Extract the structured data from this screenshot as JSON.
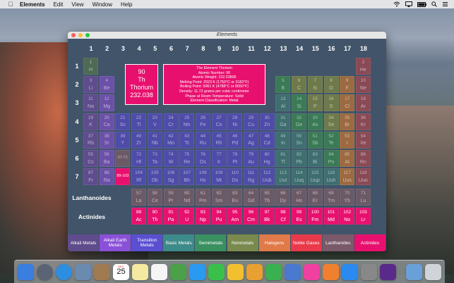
{
  "menubar": {
    "app_name": "Elements",
    "items": [
      "Edit",
      "View",
      "Window",
      "Help"
    ]
  },
  "window": {
    "title": "Elements"
  },
  "columns": [
    "1",
    "2",
    "3",
    "4",
    "5",
    "6",
    "7",
    "8",
    "9",
    "10",
    "11",
    "12",
    "13",
    "14",
    "15",
    "16",
    "17",
    "18"
  ],
  "rows": [
    "1",
    "2",
    "3",
    "4",
    "5",
    "6",
    "7"
  ],
  "series_labels": {
    "lanthanoids": "Lanthanoides",
    "actinides": "Actinides"
  },
  "selected": {
    "number": "90",
    "symbol": "Th",
    "name": "Thorium",
    "weight": "232.038"
  },
  "info": {
    "lines": [
      "The Element Thorium",
      "Atomic Number: 90",
      "Atomic Weight: 232.03806",
      "Melting Point: 2023 K (1750°C or 3182°F)",
      "Boiling Point: 5061 K (4788°C or 8650°F)",
      "Density: 11.72 grams per cubic centimeter",
      "Phase at Room Temperature: Solid",
      "Element Classification: Metal"
    ]
  },
  "colors": {
    "alkali": "#5f4c8c",
    "alkaline": "#6b50a8",
    "transition": "#4e4ca8",
    "basic": "#3e6e70",
    "semimetal": "#3a7a55",
    "nonmetal": "#6e7a4a",
    "halogen": "#9c6a40",
    "noble": "#8a4a55",
    "lanthanide": "#6b5a66",
    "actinide": "#e8106e",
    "hydrogen": "#4e6a55",
    "lan_ph": "#5a4c8a"
  },
  "elements": [
    {
      "n": "1",
      "s": "H",
      "c": "hydrogen",
      "r": 1,
      "g": 1
    },
    {
      "n": "2",
      "s": "He",
      "c": "noble",
      "r": 1,
      "g": 18
    },
    {
      "n": "3",
      "s": "Li",
      "c": "alkali",
      "r": 2,
      "g": 1
    },
    {
      "n": "4",
      "s": "Be",
      "c": "alkaline",
      "r": 2,
      "g": 2
    },
    {
      "n": "5",
      "s": "B",
      "c": "semimetal",
      "r": 2,
      "g": 13
    },
    {
      "n": "6",
      "s": "C",
      "c": "nonmetal",
      "r": 2,
      "g": 14
    },
    {
      "n": "7",
      "s": "N",
      "c": "nonmetal",
      "r": 2,
      "g": 15
    },
    {
      "n": "8",
      "s": "O",
      "c": "nonmetal",
      "r": 2,
      "g": 16
    },
    {
      "n": "9",
      "s": "F",
      "c": "halogen",
      "r": 2,
      "g": 17
    },
    {
      "n": "10",
      "s": "Ne",
      "c": "noble",
      "r": 2,
      "g": 18
    },
    {
      "n": "11",
      "s": "Na",
      "c": "alkali",
      "r": 3,
      "g": 1
    },
    {
      "n": "12",
      "s": "Mg",
      "c": "alkaline",
      "r": 3,
      "g": 2
    },
    {
      "n": "13",
      "s": "Al",
      "c": "basic",
      "r": 3,
      "g": 13
    },
    {
      "n": "14",
      "s": "Si",
      "c": "semimetal",
      "r": 3,
      "g": 14
    },
    {
      "n": "15",
      "s": "P",
      "c": "nonmetal",
      "r": 3,
      "g": 15
    },
    {
      "n": "16",
      "s": "S",
      "c": "nonmetal",
      "r": 3,
      "g": 16
    },
    {
      "n": "17",
      "s": "Cl",
      "c": "halogen",
      "r": 3,
      "g": 17
    },
    {
      "n": "18",
      "s": "Ar",
      "c": "noble",
      "r": 3,
      "g": 18
    },
    {
      "n": "19",
      "s": "K",
      "c": "alkali",
      "r": 4,
      "g": 1
    },
    {
      "n": "20",
      "s": "Ca",
      "c": "alkaline",
      "r": 4,
      "g": 2
    },
    {
      "n": "21",
      "s": "Sc",
      "c": "transition",
      "r": 4,
      "g": 3
    },
    {
      "n": "22",
      "s": "Ti",
      "c": "transition",
      "r": 4,
      "g": 4
    },
    {
      "n": "23",
      "s": "V",
      "c": "transition",
      "r": 4,
      "g": 5
    },
    {
      "n": "24",
      "s": "Cr",
      "c": "transition",
      "r": 4,
      "g": 6
    },
    {
      "n": "25",
      "s": "Mn",
      "c": "transition",
      "r": 4,
      "g": 7
    },
    {
      "n": "26",
      "s": "Fe",
      "c": "transition",
      "r": 4,
      "g": 8
    },
    {
      "n": "27",
      "s": "Co",
      "c": "transition",
      "r": 4,
      "g": 9
    },
    {
      "n": "28",
      "s": "Ni",
      "c": "transition",
      "r": 4,
      "g": 10
    },
    {
      "n": "29",
      "s": "Cu",
      "c": "transition",
      "r": 4,
      "g": 11
    },
    {
      "n": "30",
      "s": "Zn",
      "c": "transition",
      "r": 4,
      "g": 12
    },
    {
      "n": "31",
      "s": "Ga",
      "c": "basic",
      "r": 4,
      "g": 13
    },
    {
      "n": "32",
      "s": "Ge",
      "c": "semimetal",
      "r": 4,
      "g": 14
    },
    {
      "n": "33",
      "s": "As",
      "c": "semimetal",
      "r": 4,
      "g": 15
    },
    {
      "n": "34",
      "s": "Se",
      "c": "nonmetal",
      "r": 4,
      "g": 16
    },
    {
      "n": "35",
      "s": "Br",
      "c": "halogen",
      "r": 4,
      "g": 17
    },
    {
      "n": "36",
      "s": "Kr",
      "c": "noble",
      "r": 4,
      "g": 18
    },
    {
      "n": "37",
      "s": "Rb",
      "c": "alkali",
      "r": 5,
      "g": 1
    },
    {
      "n": "38",
      "s": "Sr",
      "c": "alkaline",
      "r": 5,
      "g": 2
    },
    {
      "n": "39",
      "s": "Y",
      "c": "transition",
      "r": 5,
      "g": 3
    },
    {
      "n": "40",
      "s": "Zr",
      "c": "transition",
      "r": 5,
      "g": 4
    },
    {
      "n": "41",
      "s": "Nb",
      "c": "transition",
      "r": 5,
      "g": 5
    },
    {
      "n": "42",
      "s": "Mo",
      "c": "transition",
      "r": 5,
      "g": 6
    },
    {
      "n": "43",
      "s": "Tc",
      "c": "transition",
      "r": 5,
      "g": 7
    },
    {
      "n": "44",
      "s": "Ru",
      "c": "transition",
      "r": 5,
      "g": 8
    },
    {
      "n": "45",
      "s": "Rh",
      "c": "transition",
      "r": 5,
      "g": 9
    },
    {
      "n": "46",
      "s": "Pd",
      "c": "transition",
      "r": 5,
      "g": 10
    },
    {
      "n": "47",
      "s": "Ag",
      "c": "transition",
      "r": 5,
      "g": 11
    },
    {
      "n": "48",
      "s": "Cd",
      "c": "transition",
      "r": 5,
      "g": 12
    },
    {
      "n": "49",
      "s": "In",
      "c": "basic",
      "r": 5,
      "g": 13
    },
    {
      "n": "50",
      "s": "Sn",
      "c": "basic",
      "r": 5,
      "g": 14
    },
    {
      "n": "51",
      "s": "Sb",
      "c": "semimetal",
      "r": 5,
      "g": 15
    },
    {
      "n": "52",
      "s": "Te",
      "c": "semimetal",
      "r": 5,
      "g": 16
    },
    {
      "n": "53",
      "s": "I",
      "c": "halogen",
      "r": 5,
      "g": 17
    },
    {
      "n": "54",
      "s": "Xe",
      "c": "noble",
      "r": 5,
      "g": 18
    },
    {
      "n": "55",
      "s": "Cs",
      "c": "alkali",
      "r": 6,
      "g": 1
    },
    {
      "n": "56",
      "s": "Ba",
      "c": "alkaline",
      "r": 6,
      "g": 2
    },
    {
      "n": "",
      "s": "57-71",
      "c": "lanthanide",
      "r": 6,
      "g": 3
    },
    {
      "n": "72",
      "s": "Hf",
      "c": "transition",
      "r": 6,
      "g": 4
    },
    {
      "n": "73",
      "s": "Ta",
      "c": "transition",
      "r": 6,
      "g": 5
    },
    {
      "n": "74",
      "s": "W",
      "c": "transition",
      "r": 6,
      "g": 6
    },
    {
      "n": "75",
      "s": "Re",
      "c": "transition",
      "r": 6,
      "g": 7
    },
    {
      "n": "76",
      "s": "Os",
      "c": "transition",
      "r": 6,
      "g": 8
    },
    {
      "n": "77",
      "s": "Ir",
      "c": "transition",
      "r": 6,
      "g": 9
    },
    {
      "n": "78",
      "s": "Pt",
      "c": "transition",
      "r": 6,
      "g": 10
    },
    {
      "n": "79",
      "s": "Au",
      "c": "transition",
      "r": 6,
      "g": 11
    },
    {
      "n": "80",
      "s": "Hg",
      "c": "transition",
      "r": 6,
      "g": 12
    },
    {
      "n": "81",
      "s": "Tl",
      "c": "basic",
      "r": 6,
      "g": 13
    },
    {
      "n": "82",
      "s": "Pb",
      "c": "basic",
      "r": 6,
      "g": 14
    },
    {
      "n": "83",
      "s": "Bi",
      "c": "basic",
      "r": 6,
      "g": 15
    },
    {
      "n": "84",
      "s": "Po",
      "c": "semimetal",
      "r": 6,
      "g": 16
    },
    {
      "n": "85",
      "s": "At",
      "c": "halogen",
      "r": 6,
      "g": 17
    },
    {
      "n": "86",
      "s": "Rn",
      "c": "noble",
      "r": 6,
      "g": 18
    },
    {
      "n": "87",
      "s": "Fr",
      "c": "alkali",
      "r": 7,
      "g": 1
    },
    {
      "n": "88",
      "s": "Ra",
      "c": "alkaline",
      "r": 7,
      "g": 2
    },
    {
      "n": "",
      "s": "89-103",
      "c": "actinide",
      "r": 7,
      "g": 3,
      "hl": true
    },
    {
      "n": "104",
      "s": "Rf",
      "c": "transition",
      "r": 7,
      "g": 4
    },
    {
      "n": "105",
      "s": "Db",
      "c": "transition",
      "r": 7,
      "g": 5
    },
    {
      "n": "106",
      "s": "Sg",
      "c": "transition",
      "r": 7,
      "g": 6
    },
    {
      "n": "107",
      "s": "Bh",
      "c": "transition",
      "r": 7,
      "g": 7
    },
    {
      "n": "108",
      "s": "Hs",
      "c": "transition",
      "r": 7,
      "g": 8
    },
    {
      "n": "109",
      "s": "Mt",
      "c": "transition",
      "r": 7,
      "g": 9
    },
    {
      "n": "110",
      "s": "Ds",
      "c": "transition",
      "r": 7,
      "g": 10
    },
    {
      "n": "111",
      "s": "Rg",
      "c": "transition",
      "r": 7,
      "g": 11
    },
    {
      "n": "112",
      "s": "Uub",
      "c": "transition",
      "r": 7,
      "g": 12
    },
    {
      "n": "113",
      "s": "Uut",
      "c": "basic",
      "r": 7,
      "g": 13
    },
    {
      "n": "114",
      "s": "Uuq",
      "c": "basic",
      "r": 7,
      "g": 14
    },
    {
      "n": "115",
      "s": "Uup",
      "c": "basic",
      "r": 7,
      "g": 15
    },
    {
      "n": "116",
      "s": "Uuh",
      "c": "basic",
      "r": 7,
      "g": 16
    },
    {
      "n": "117",
      "s": "Uus",
      "c": "halogen",
      "r": 7,
      "g": 17
    },
    {
      "n": "118",
      "s": "Uuo",
      "c": "noble",
      "r": 7,
      "g": 18
    },
    {
      "n": "57",
      "s": "La",
      "c": "lanthanide",
      "r": 8,
      "g": 4
    },
    {
      "n": "58",
      "s": "Ce",
      "c": "lanthanide",
      "r": 8,
      "g": 5
    },
    {
      "n": "59",
      "s": "Pr",
      "c": "lanthanide",
      "r": 8,
      "g": 6
    },
    {
      "n": "60",
      "s": "Nd",
      "c": "lanthanide",
      "r": 8,
      "g": 7
    },
    {
      "n": "61",
      "s": "Pm",
      "c": "lanthanide",
      "r": 8,
      "g": 8
    },
    {
      "n": "62",
      "s": "Sm",
      "c": "lanthanide",
      "r": 8,
      "g": 9
    },
    {
      "n": "63",
      "s": "Eu",
      "c": "lanthanide",
      "r": 8,
      "g": 10
    },
    {
      "n": "64",
      "s": "Gd",
      "c": "lanthanide",
      "r": 8,
      "g": 11
    },
    {
      "n": "65",
      "s": "Tb",
      "c": "lanthanide",
      "r": 8,
      "g": 12
    },
    {
      "n": "66",
      "s": "Dy",
      "c": "lanthanide",
      "r": 8,
      "g": 13
    },
    {
      "n": "67",
      "s": "Ho",
      "c": "lanthanide",
      "r": 8,
      "g": 14
    },
    {
      "n": "68",
      "s": "Er",
      "c": "lanthanide",
      "r": 8,
      "g": 15
    },
    {
      "n": "69",
      "s": "Tm",
      "c": "lanthanide",
      "r": 8,
      "g": 16
    },
    {
      "n": "70",
      "s": "Yb",
      "c": "lanthanide",
      "r": 8,
      "g": 17
    },
    {
      "n": "71",
      "s": "Lu",
      "c": "lanthanide",
      "r": 8,
      "g": 18
    },
    {
      "n": "89",
      "s": "Ac",
      "c": "actinide",
      "r": 9,
      "g": 4,
      "hl": true
    },
    {
      "n": "90",
      "s": "Th",
      "c": "actinide",
      "r": 9,
      "g": 5,
      "hl": true
    },
    {
      "n": "91",
      "s": "Pa",
      "c": "actinide",
      "r": 9,
      "g": 6,
      "hl": true
    },
    {
      "n": "92",
      "s": "U",
      "c": "actinide",
      "r": 9,
      "g": 7,
      "hl": true
    },
    {
      "n": "93",
      "s": "Np",
      "c": "actinide",
      "r": 9,
      "g": 8,
      "hl": true
    },
    {
      "n": "94",
      "s": "Pu",
      "c": "actinide",
      "r": 9,
      "g": 9,
      "hl": true
    },
    {
      "n": "95",
      "s": "Am",
      "c": "actinide",
      "r": 9,
      "g": 10,
      "hl": true
    },
    {
      "n": "96",
      "s": "Cm",
      "c": "actinide",
      "r": 9,
      "g": 11,
      "hl": true
    },
    {
      "n": "97",
      "s": "Bk",
      "c": "actinide",
      "r": 9,
      "g": 12,
      "hl": true
    },
    {
      "n": "98",
      "s": "Cf",
      "c": "actinide",
      "r": 9,
      "g": 13,
      "hl": true
    },
    {
      "n": "99",
      "s": "Es",
      "c": "actinide",
      "r": 9,
      "g": 14,
      "hl": true
    },
    {
      "n": "100",
      "s": "Fm",
      "c": "actinide",
      "r": 9,
      "g": 15,
      "hl": true
    },
    {
      "n": "101",
      "s": "Md",
      "c": "actinide",
      "r": 9,
      "g": 16,
      "hl": true
    },
    {
      "n": "102",
      "s": "No",
      "c": "actinide",
      "r": 9,
      "g": 17,
      "hl": true
    },
    {
      "n": "103",
      "s": "Lr",
      "c": "actinide",
      "r": 9,
      "g": 18,
      "hl": true
    }
  ],
  "legend": [
    {
      "label": "Alkali Metals",
      "color": "#5f4c8c"
    },
    {
      "label": "Alkali Earth Metals",
      "color": "#8a50d8"
    },
    {
      "label": "Transition Metals",
      "color": "#5a4fd0"
    },
    {
      "label": "Basic Metals",
      "color": "#3d8a8a"
    },
    {
      "label": "Semimetals",
      "color": "#3a9060"
    },
    {
      "label": "Nonmetals",
      "color": "#7a8a4e"
    },
    {
      "label": "Halogens",
      "color": "#e07a48"
    },
    {
      "label": "Noble Gases",
      "color": "#e83a4a"
    },
    {
      "label": "Lanthanides",
      "color": "#7a5a6a"
    },
    {
      "label": "Actinides",
      "color": "#e8106e"
    }
  ],
  "dock": [
    "finder-icon",
    "launchpad-icon",
    "safari-icon",
    "preview-icon",
    "contacts-icon",
    "calendar-icon",
    "notes-icon",
    "reminders-icon",
    "maps-icon",
    "messages-icon",
    "facetime-icon",
    "photos-icon",
    "pages-icon",
    "numbers-icon",
    "keynote-icon",
    "itunes-icon",
    "ibooks-icon",
    "app-store-icon",
    "system-preferences-icon",
    "elements-icon",
    "downloads-icon",
    "trash-icon"
  ],
  "calendar": {
    "month": "DEC",
    "day": "25"
  }
}
